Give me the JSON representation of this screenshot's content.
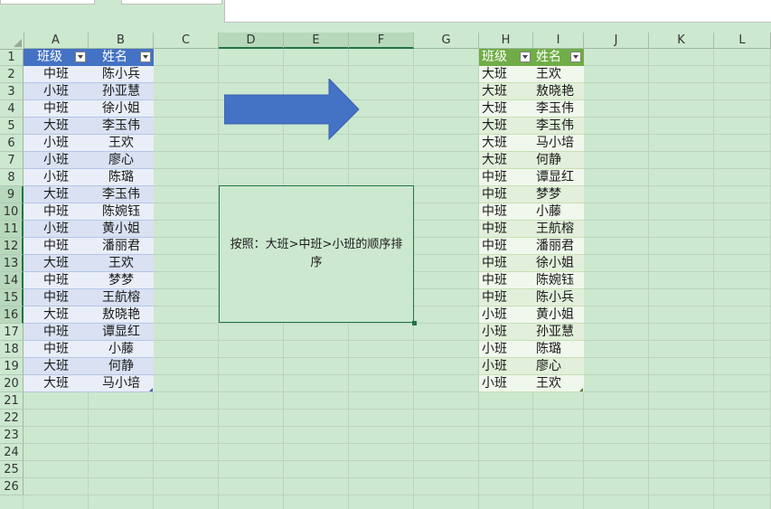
{
  "columns": [
    "A",
    "B",
    "C",
    "D",
    "E",
    "F",
    "G",
    "H",
    "I",
    "J",
    "K",
    "L"
  ],
  "rows": [
    "1",
    "2",
    "3",
    "4",
    "5",
    "6",
    "7",
    "8",
    "9",
    "10",
    "11",
    "12",
    "13",
    "14",
    "15",
    "16",
    "17",
    "18",
    "19",
    "20",
    "21",
    "22",
    "23",
    "24",
    "25",
    "26"
  ],
  "left_table": {
    "headers": [
      "班级",
      "姓名"
    ],
    "rows": [
      [
        "中班",
        "陈小兵"
      ],
      [
        "小班",
        "孙亚慧"
      ],
      [
        "中班",
        "徐小姐"
      ],
      [
        "大班",
        "李玉伟"
      ],
      [
        "小班",
        "王欢"
      ],
      [
        "小班",
        "廖心"
      ],
      [
        "小班",
        "陈璐"
      ],
      [
        "大班",
        "李玉伟"
      ],
      [
        "中班",
        "陈婉钰"
      ],
      [
        "小班",
        "黄小姐"
      ],
      [
        "中班",
        "潘丽君"
      ],
      [
        "大班",
        "王欢"
      ],
      [
        "中班",
        "梦梦"
      ],
      [
        "中班",
        "王航榕"
      ],
      [
        "大班",
        "敖晓艳"
      ],
      [
        "中班",
        "谭显红"
      ],
      [
        "中班",
        "小藤"
      ],
      [
        "大班",
        "何静"
      ],
      [
        "大班",
        "马小培"
      ]
    ],
    "header_color": "#4472c4",
    "band_color": "#d9e1f2"
  },
  "right_table": {
    "headers": [
      "班级",
      "姓名"
    ],
    "rows": [
      [
        "大班",
        "王欢"
      ],
      [
        "大班",
        "敖晓艳"
      ],
      [
        "大班",
        "李玉伟"
      ],
      [
        "大班",
        "李玉伟"
      ],
      [
        "大班",
        "马小培"
      ],
      [
        "大班",
        "何静"
      ],
      [
        "中班",
        "谭显红"
      ],
      [
        "中班",
        "梦梦"
      ],
      [
        "中班",
        "小藤"
      ],
      [
        "中班",
        "王航榕"
      ],
      [
        "中班",
        "潘丽君"
      ],
      [
        "中班",
        "徐小姐"
      ],
      [
        "中班",
        "陈婉钰"
      ],
      [
        "中班",
        "陈小兵"
      ],
      [
        "小班",
        "黄小姐"
      ],
      [
        "小班",
        "孙亚慧"
      ],
      [
        "小班",
        "陈璐"
      ],
      [
        "小班",
        "廖心"
      ],
      [
        "小班",
        "王欢"
      ]
    ],
    "header_color": "#70ad47",
    "band_color": "#e2efda"
  },
  "note": {
    "text": "按照：大班>中班>小班的顺序排序"
  },
  "arrow": {
    "icon": "right-arrow-shape",
    "color": "#4472c4"
  }
}
